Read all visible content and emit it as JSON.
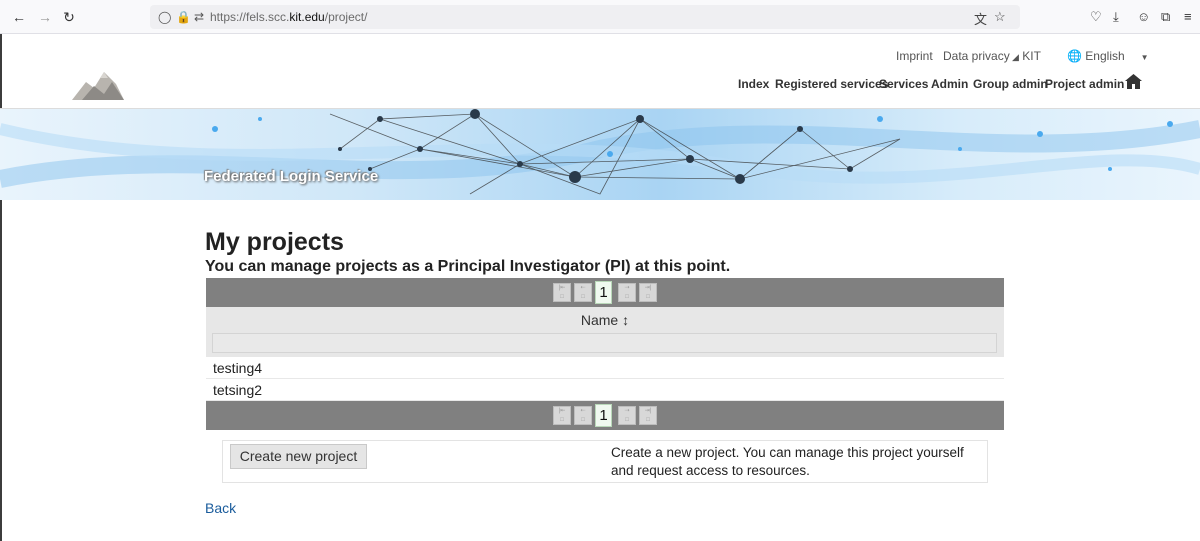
{
  "browser": {
    "url_host": "fels.scc.",
    "url_domain": "kit.edu",
    "url_path": "/project/"
  },
  "header": {
    "top_links": [
      "Imprint",
      "Data privacy",
      "KIT",
      "English"
    ],
    "nav": [
      "Index",
      "Registered services",
      "Services",
      "Admin",
      "Group admin",
      "Project admin"
    ]
  },
  "banner": {
    "title": "Federated Login Service"
  },
  "main": {
    "title": "My projects",
    "subtitle": "You can manage projects as a Principal Investigator (PI) at this point.",
    "current_page": "1",
    "column_name": "Name ↕",
    "rows": [
      "testing4",
      "tetsing2"
    ]
  },
  "actions": {
    "create_label": "Create new project",
    "help_text": "Create a new project. You can manage this project yourself and request access to resources."
  },
  "footer": {
    "back_label": "Back"
  }
}
